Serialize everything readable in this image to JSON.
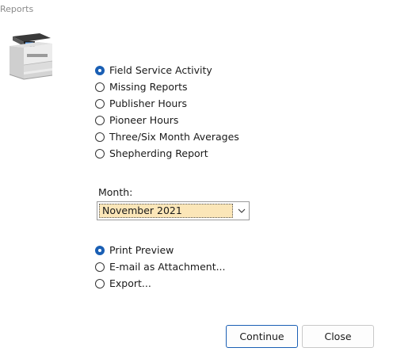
{
  "window": {
    "title": "Reports"
  },
  "report_types": [
    {
      "label": "Field Service Activity",
      "checked": true
    },
    {
      "label": "Missing Reports",
      "checked": false
    },
    {
      "label": "Publisher Hours",
      "checked": false
    },
    {
      "label": "Pioneer Hours",
      "checked": false
    },
    {
      "label": "Three/Six Month Averages",
      "checked": false
    },
    {
      "label": "Shepherding Report",
      "checked": false
    }
  ],
  "month": {
    "label": "Month:",
    "selected": "November 2021"
  },
  "output_options": [
    {
      "label": "Print Preview",
      "checked": true
    },
    {
      "label": "E-mail as Attachment...",
      "checked": false
    },
    {
      "label": "Export...",
      "checked": false
    }
  ],
  "buttons": {
    "continue": "Continue",
    "close": "Close"
  },
  "icons": {
    "printer": "printer-icon",
    "dropdown": "chevron-down-icon"
  },
  "colors": {
    "accent": "#1a5fb4",
    "selection": "#fbe6b8"
  }
}
